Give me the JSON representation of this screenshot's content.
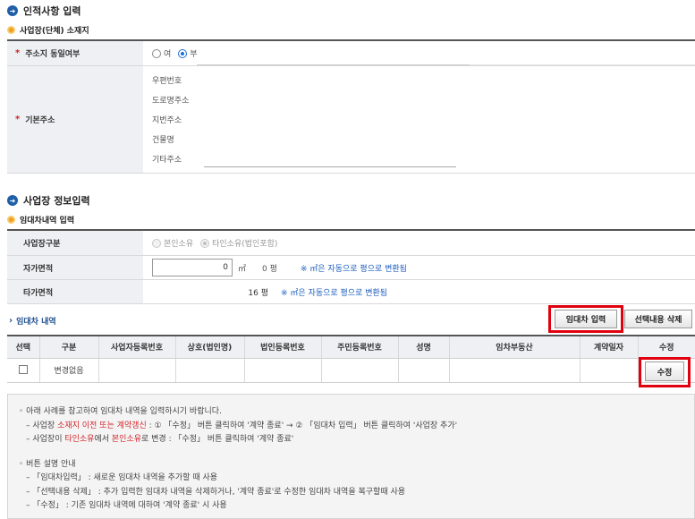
{
  "section1": {
    "title": "인적사항 입력",
    "sub": "사업장(단체) 소재지"
  },
  "same_address": {
    "label": "주소지 동일여부",
    "options": [
      "여",
      "부"
    ],
    "selected": "부"
  },
  "base_address": {
    "label": "기본주소",
    "fields": [
      "우편번호",
      "도로명주소",
      "지번주소",
      "건물명",
      "기타주소"
    ]
  },
  "section2": {
    "title": "사업장 정보입력",
    "sub": "임대차내역 입력"
  },
  "workplace_type": {
    "label": "사업장구분",
    "options": [
      "본인소유",
      "타인소유(법인포함)"
    ],
    "selected": "타인소유(법인포함)"
  },
  "own_area": {
    "label": "자가면적",
    "value": "0",
    "unit": "㎡",
    "pyeong": "0 평",
    "note": "※ ㎡은 자동으로 평으로 변환됨"
  },
  "other_area": {
    "label": "타가면적",
    "pyeong": "16 평",
    "note": "※ ㎡은 자동으로 평으로 변환됨"
  },
  "lease": {
    "title": "임대차 내역",
    "input_button": "임대차 입력",
    "delete_button": "선택내용 삭제",
    "columns": [
      "선택",
      "구분",
      "사업자등록번호",
      "상호(법인명)",
      "법인등록번호",
      "주민등록번호",
      "성명",
      "임차부동산",
      "계약일자",
      "수정"
    ],
    "rows": [
      {
        "type": "변경없음",
        "edit": "수정"
      }
    ]
  },
  "notes": {
    "l1": "◦ 아래 사례를 참고하여 임대차 내역을 입력하시기 바랍니다.",
    "l2a": "– 사업장 ",
    "l2b": "소재지 이전 또는 계약갱신",
    "l2c": " : ① 「수정」 버튼 클릭하여 '계약 종료' → ② 「임대차 입력」 버튼 클릭하여 '사업장 추가'",
    "l3a": "– 사업장이 ",
    "l3b": "타인소유",
    "l3c": "에서 ",
    "l3d": "본인소유",
    "l3e": "로 변경 : 「수정」 버튼 클릭하여 '계약 종료'",
    "l4": "◦ 버튼 설명 안내",
    "l5": "– 「임대차입력」 : 새로운 임대차 내역을 추가할 때 사용",
    "l6": "– 「선택내용 삭제」 : 추가 입력한 임대차 내역을 삭제하거나, '계약 종료'로 수정한 임대차 내역을 복구할때 사용",
    "l7": "– 「수정」 : 기존 임대차 내역에 대하여 '계약 종료' 시 사용"
  }
}
